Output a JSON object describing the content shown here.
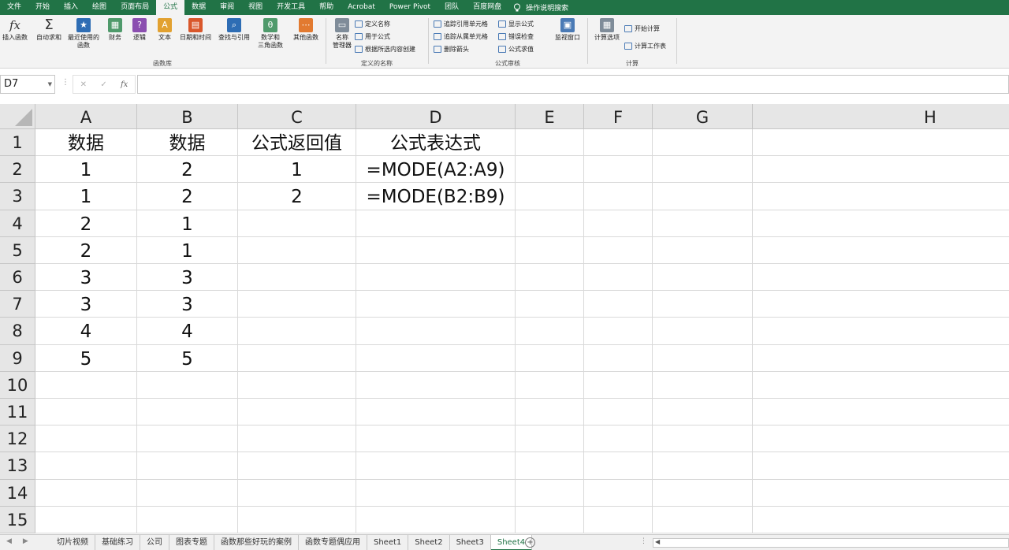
{
  "menu": {
    "tabs": [
      "文件",
      "开始",
      "插入",
      "绘图",
      "页面布局",
      "公式",
      "数据",
      "审阅",
      "视图",
      "开发工具",
      "帮助",
      "Acrobat",
      "Power Pivot",
      "团队",
      "百度网盘"
    ],
    "active_index": 5,
    "tell_me": "操作说明搜索"
  },
  "ribbon": {
    "function_library": {
      "label": "函数库",
      "buttons": [
        "插入函数",
        "自动求和",
        "最近使用的\n函数",
        "财务",
        "逻辑",
        "文本",
        "日期和时间",
        "查找与引用",
        "数学和\n三角函数",
        "其他函数"
      ]
    },
    "defined_names": {
      "label": "定义的名称",
      "big": "名称\n管理器",
      "small": [
        "定义名称",
        "用于公式",
        "根据所选内容创建"
      ]
    },
    "formula_auditing": {
      "label": "公式审核",
      "small": [
        "追踪引用单元格",
        "追踪从属单元格",
        "删除箭头",
        "显示公式",
        "错误检查",
        "公式求值"
      ],
      "watch": "监视窗口"
    },
    "calculation": {
      "label": "计算",
      "big": "计算选项",
      "small": [
        "开始计算",
        "计算工作表"
      ]
    }
  },
  "formula_bar": {
    "name_box": "D7",
    "value": ""
  },
  "columns": [
    "A",
    "B",
    "C",
    "D",
    "E",
    "F",
    "G",
    "H"
  ],
  "rows": [
    "1",
    "2",
    "3",
    "4",
    "5",
    "6",
    "7",
    "8",
    "9",
    "10",
    "11",
    "12",
    "13",
    "14",
    "15"
  ],
  "cells": {
    "A": [
      "数据",
      "1",
      "1",
      "2",
      "2",
      "3",
      "3",
      "4",
      "5"
    ],
    "B": [
      "数据",
      "2",
      "2",
      "1",
      "1",
      "3",
      "3",
      "4",
      "5"
    ],
    "C": [
      "公式返回值",
      "1",
      "2"
    ],
    "D": [
      "公式表达式",
      "=MODE(A2:A9)",
      "=MODE(B2:B9)"
    ]
  },
  "sheets": [
    "切片视频",
    "基础练习",
    "公司",
    "图表专题",
    "函数那些好玩的案例",
    "函数专题偶应用",
    "Sheet1",
    "Sheet2",
    "Sheet3",
    "Sheet4"
  ],
  "active_sheet_index": 9,
  "colors": {
    "accent": "#217346"
  }
}
